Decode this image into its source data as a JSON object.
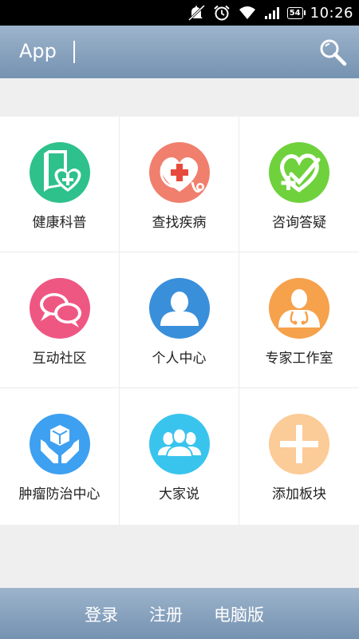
{
  "status_bar": {
    "time": "10:26",
    "battery": "54",
    "icons": [
      "mute-icon",
      "alarm-icon",
      "wifi-icon",
      "signal-icon",
      "battery-icon"
    ]
  },
  "header": {
    "title": "App",
    "search_icon": "search-icon"
  },
  "grid": {
    "items": [
      {
        "label": "健康科普",
        "icon": "health-book-icon",
        "color": "#2ec18b"
      },
      {
        "label": "查找疾病",
        "icon": "stethoscope-heart-icon",
        "color": "#f07f6d"
      },
      {
        "label": "咨询答疑",
        "icon": "heart-plus-icon",
        "color": "#6fd13c"
      },
      {
        "label": "互动社区",
        "icon": "chat-bubbles-icon",
        "color": "#ef5783"
      },
      {
        "label": "个人中心",
        "icon": "person-icon",
        "color": "#3a8fdb"
      },
      {
        "label": "专家工作室",
        "icon": "doctor-icon",
        "color": "#f6a14b"
      },
      {
        "label": "肿瘤防治中心",
        "icon": "hands-cube-icon",
        "color": "#3ea0f0"
      },
      {
        "label": "大家说",
        "icon": "people-group-icon",
        "color": "#39c4ed"
      },
      {
        "label": "添加板块",
        "icon": "add-icon",
        "color": "#fbcb98"
      }
    ]
  },
  "footer": {
    "login": "登录",
    "register": "注册",
    "desktop": "电脑版"
  }
}
